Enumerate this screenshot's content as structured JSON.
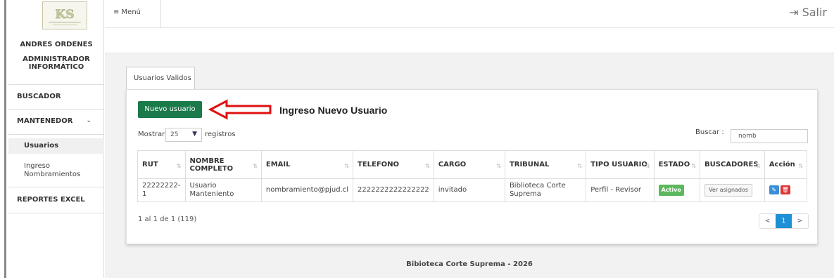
{
  "sidebar": {
    "user_name": "ANDRES ORDENES",
    "user_role": "ADMINISTRADOR INFORMÁTICO",
    "items": [
      {
        "label": "BUSCADOR"
      },
      {
        "label": "MANTENEDOR"
      },
      {
        "label": "Usuarios"
      },
      {
        "label": "Ingreso Nombramientos"
      },
      {
        "label": "REPORTES EXCEL"
      }
    ]
  },
  "topbar": {
    "menu_label": "≡ Menú",
    "logout_label": "⇥ Salir"
  },
  "tabs": [
    {
      "label": "Usuarios Validos"
    }
  ],
  "toolbar": {
    "new_user_label": "Nuevo usuario",
    "annotation": "Ingreso Nuevo Usuario",
    "annotation_color": "#e01010"
  },
  "length": {
    "prefix": "Mostrar",
    "value": "25",
    "suffix": "registros"
  },
  "search": {
    "label": "Buscar :",
    "value": "nomb"
  },
  "table": {
    "headers": [
      "RUT",
      "NOMBRE COMPLETO",
      "EMAIL",
      "TELEFONO",
      "CARGO",
      "TRIBUNAL",
      "TIPO USUARIO",
      "ESTADO",
      "BUSCADORES",
      "Acción"
    ],
    "rows": [
      {
        "rut": "22222222-1",
        "nombre": "Usuario Manteniento",
        "email": "nombramiento@pjud.cl",
        "telefono": "2222222222222222",
        "cargo": "invitado",
        "tribunal": "Biblioteca Corte Suprema",
        "tipo": "Perfil - Revisor",
        "estado": "Activo",
        "buscadores": "Ver asignados"
      }
    ]
  },
  "info": "1 al 1 de 1 (119)",
  "pagination": {
    "prev": "<",
    "current": "1",
    "next": ">"
  },
  "footer": "Bibioteca Corte Suprema - 2026",
  "colors": {
    "primary_button": "#1a7a4a",
    "status_active": "#5cb85c",
    "edit": "#3a8fd6",
    "delete": "#e03434",
    "page_active": "#1e90d6"
  }
}
